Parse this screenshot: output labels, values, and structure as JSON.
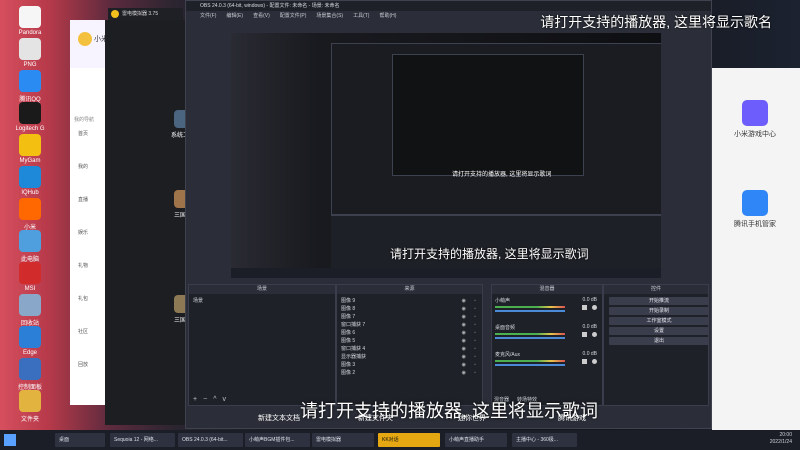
{
  "desktop": {
    "left_icons": [
      {
        "label": "Pandora",
        "color": "#f6f6f6"
      },
      {
        "label": "PNG",
        "color": "#e4e4e4"
      },
      {
        "label": "腾讯QQ",
        "color": "#2a8cf2"
      },
      {
        "label": "Logitech G",
        "color": "#1a1a1a"
      },
      {
        "label": "MyGam",
        "color": "#f3c012"
      },
      {
        "label": "IQHub",
        "color": "#1e88d9"
      },
      {
        "label": "小米",
        "color": "#ff6700"
      },
      {
        "label": "此电脑",
        "color": "#4f9ede"
      },
      {
        "label": "MSI",
        "color": "#d12b2b"
      },
      {
        "label": "回收站",
        "color": "#89a7c8"
      },
      {
        "label": "Edge",
        "color": "#2c7fd6"
      },
      {
        "label": "控制面板",
        "color": "#3a6fbf"
      },
      {
        "label": "文件夹",
        "color": "#e2b33e"
      }
    ],
    "right_icons": [
      {
        "label": "小米游戏中心",
        "color": "#6d5dfc"
      },
      {
        "label": "腾讯手机管家",
        "color": "#2f86f6"
      }
    ],
    "game_icons": [
      {
        "label": "系统工具",
        "color": "#4b6480"
      },
      {
        "label": "三国志",
        "color": "#a0744a"
      },
      {
        "label": "三国志",
        "color": "#8d7a55"
      }
    ]
  },
  "game_center": {
    "title": "小米",
    "menu": [
      "首页",
      "我的",
      "直播",
      "娱乐",
      "礼物",
      "礼包",
      "社区",
      "回放"
    ],
    "section": "我的导航"
  },
  "launcher": {
    "title": "雷电模拟器 3.75"
  },
  "obs": {
    "title": "OBS 24.0.3 (64-bit, windows) - 配置文件: 未命名 - 场景: 未命名",
    "menu": [
      "文件(F)",
      "编辑(E)",
      "查看(V)",
      "配置文件(P)",
      "场景集合(S)",
      "工具(T)",
      "帮助(H)"
    ],
    "docks": {
      "scenes": {
        "title": "场景",
        "items": [
          "场景"
        ]
      },
      "sources": {
        "title": "来源",
        "items": [
          "图像 9",
          "图像 8",
          "图像 7",
          "窗口捕获 7",
          "图像 6",
          "图像 5",
          "窗口捕获 4",
          "显示器捕获",
          "图像 3",
          "图像 2"
        ]
      },
      "mixer": {
        "title": "混音器",
        "channels": [
          {
            "name": "小萌声",
            "value": "0.0 dB"
          },
          {
            "name": "桌面音频",
            "value": "0.0 dB"
          },
          {
            "name": "麦克风/Aux",
            "value": "0.0 dB"
          }
        ]
      },
      "controls": {
        "title": "控件",
        "buttons": [
          "开始推流",
          "开始录制",
          "工作室模式",
          "设置",
          "退出"
        ]
      }
    },
    "footer_tabs": [
      "混音器",
      "转场特效"
    ],
    "toolbar_glyphs": [
      "+",
      "−",
      "^",
      "v"
    ]
  },
  "subtitles": {
    "top": "请打开支持的播放器, 这里将显示歌名",
    "middle": "请打开支持的播放器, 这里将显示歌词",
    "bottom": "请打开支持的播放器, 这里将显示歌词",
    "nested_small": "请打开支持的播放器, 这里将显示歌词"
  },
  "desktop_labels": {
    "bottom": [
      "新建文本文档",
      "新建文件夹",
      "迷你世界",
      "腾讯游戏"
    ]
  },
  "taskbar": {
    "items": [
      {
        "label": "桌面",
        "active": false
      },
      {
        "label": "Sequoia 12 - 网络...",
        "active": false
      },
      {
        "label": "OBS 24.0.3 (64-bit...",
        "active": false
      },
      {
        "label": "小萌声BGM插件包...",
        "active": false
      },
      {
        "label": "雷电模拟器",
        "active": false
      },
      {
        "label": "KK对话",
        "active": true
      },
      {
        "label": "小萌声直播助手",
        "active": false
      },
      {
        "label": "主播中心 - 360极...",
        "active": false
      }
    ],
    "time": "20:00",
    "date": "2022/1/24"
  },
  "colors": {
    "obs_bg": "#2b2e38",
    "accent": "#e5a712"
  }
}
